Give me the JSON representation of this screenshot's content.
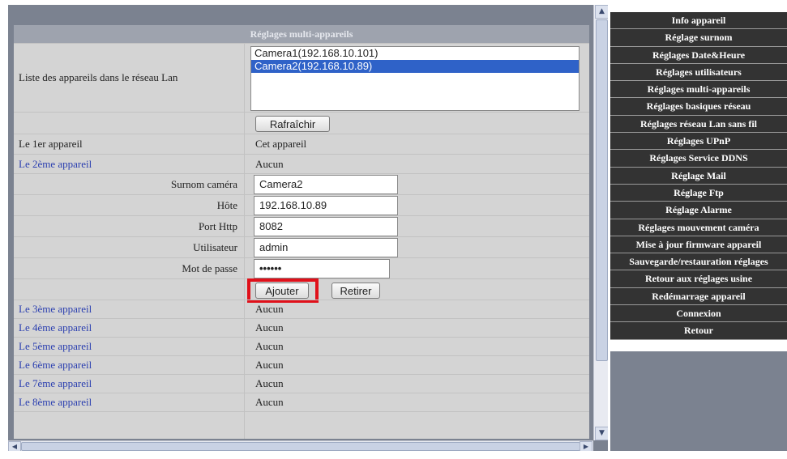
{
  "section_title": "Réglages multi-appareils",
  "lan_list": {
    "label": "Liste des appareils dans le réseau Lan",
    "options": [
      "Camera1(192.168.10.101)",
      "Camera2(192.168.10.89)"
    ],
    "selected_index": 1,
    "refresh_button": "Rafraîchir"
  },
  "device1": {
    "label": "Le 1er appareil",
    "value": "Cet appareil"
  },
  "device2": {
    "label": "Le 2ème appareil",
    "value": "Aucun"
  },
  "form": {
    "nickname_label": "Surnom caméra",
    "nickname_value": "Camera2",
    "host_label": "Hôte",
    "host_value": "192.168.10.89",
    "port_label": "Port Http",
    "port_value": "8082",
    "user_label": "Utilisateur",
    "user_value": "admin",
    "password_label": "Mot de passe",
    "password_value": "••••••",
    "add_button": "Ajouter",
    "remove_button": "Retirer"
  },
  "devices": [
    {
      "label": "Le 3ème appareil",
      "value": "Aucun"
    },
    {
      "label": "Le 4ème appareil",
      "value": "Aucun"
    },
    {
      "label": "Le 5ème appareil",
      "value": "Aucun"
    },
    {
      "label": "Le 6ème appareil",
      "value": "Aucun"
    },
    {
      "label": "Le 7ème appareil",
      "value": "Aucun"
    },
    {
      "label": "Le 8ème appareil",
      "value": "Aucun"
    }
  ],
  "menu": [
    "Info appareil",
    "Réglage surnom",
    "Réglages Date&Heure",
    "Réglages utilisateurs",
    "Réglages multi-appareils",
    "Réglages basiques réseau",
    "Réglages réseau Lan sans fil",
    "Réglages UPnP",
    "Réglages Service DDNS",
    "Réglage Mail",
    "Réglage Ftp",
    "Réglage Alarme",
    "Réglages mouvement caméra",
    "Mise à jour firmware appareil",
    "Sauvegarde/restauration réglages",
    "Retour aux réglages usine",
    "Redémarrage appareil",
    "Connexion",
    "Retour"
  ],
  "colors": {
    "highlight": "#e0101a",
    "selection": "#2f62c8",
    "menu_bg": "#333333",
    "link_blue": "#2b3fb0"
  }
}
